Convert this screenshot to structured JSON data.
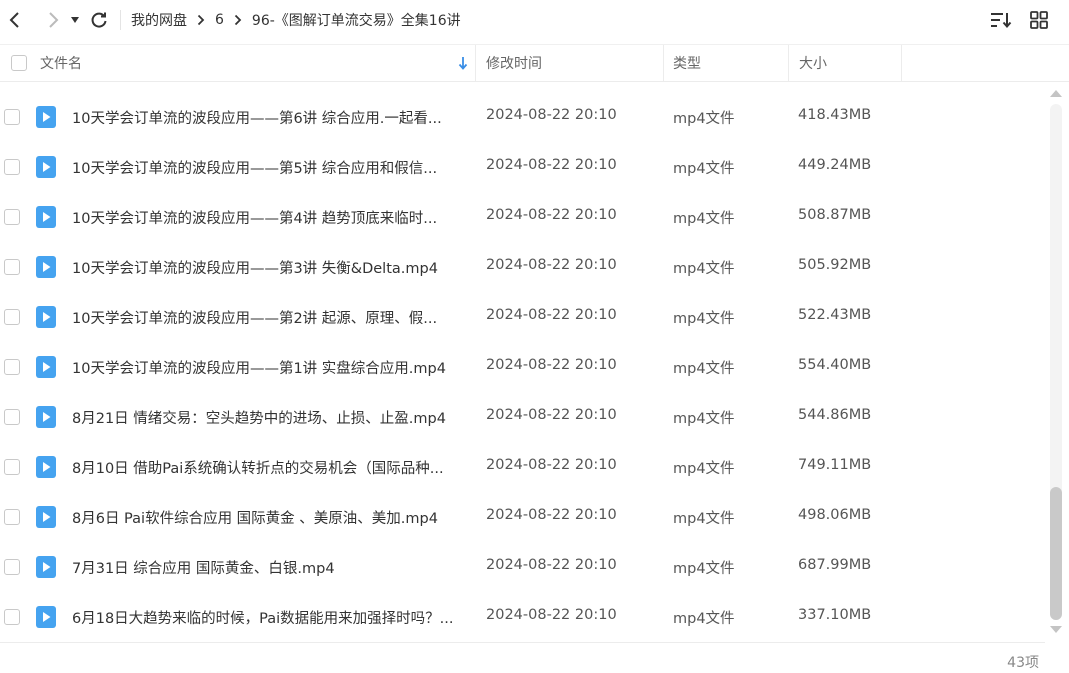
{
  "toolbar": {
    "breadcrumbs": [
      "我的网盘",
      "6",
      "96-《图解订单流交易》全集16讲"
    ]
  },
  "columns": {
    "name": "文件名",
    "modified": "修改时间",
    "type": "类型",
    "size": "大小"
  },
  "files": [
    {
      "name": "10天学会订单流的波段应用——第6讲  综合应用.一起看...",
      "time": "2024-08-22 20:10",
      "type": "mp4文件",
      "size": "418.43MB"
    },
    {
      "name": "10天学会订单流的波段应用——第5讲  综合应用和假信...",
      "time": "2024-08-22 20:10",
      "type": "mp4文件",
      "size": "449.24MB"
    },
    {
      "name": "10天学会订单流的波段应用——第4讲  趋势顶底来临时...",
      "time": "2024-08-22 20:10",
      "type": "mp4文件",
      "size": "508.87MB"
    },
    {
      "name": "10天学会订单流的波段应用——第3讲 失衡&Delta.mp4",
      "time": "2024-08-22 20:10",
      "type": "mp4文件",
      "size": "505.92MB"
    },
    {
      "name": "10天学会订单流的波段应用——第2讲  起源、原理、假...",
      "time": "2024-08-22 20:10",
      "type": "mp4文件",
      "size": "522.43MB"
    },
    {
      "name": "10天学会订单流的波段应用——第1讲  实盘综合应用.mp4",
      "time": "2024-08-22 20:10",
      "type": "mp4文件",
      "size": "554.40MB"
    },
    {
      "name": "8月21日  情绪交易：空头趋势中的进场、止损、止盈.mp4",
      "time": "2024-08-22 20:10",
      "type": "mp4文件",
      "size": "544.86MB"
    },
    {
      "name": "8月10日  借助Pai系统确认转折点的交易机会（国际品种...",
      "time": "2024-08-22 20:10",
      "type": "mp4文件",
      "size": "749.11MB"
    },
    {
      "name": "8月6日  Pai软件综合应用  国际黄金 、美原油、美加.mp4",
      "time": "2024-08-22 20:10",
      "type": "mp4文件",
      "size": "498.06MB"
    },
    {
      "name": "7月31日 综合应用 国际黄金、白银.mp4",
      "time": "2024-08-22 20:10",
      "type": "mp4文件",
      "size": "687.99MB"
    },
    {
      "name": "6月18日大趋势来临的时候，Pai数据能用来加强择时吗？...",
      "time": "2024-08-22 20:10",
      "type": "mp4文件",
      "size": "337.10MB"
    }
  ],
  "footer": {
    "count": "43项"
  },
  "colors": {
    "accent": "#3a8ee6",
    "file_icon": "#45a3f0"
  }
}
